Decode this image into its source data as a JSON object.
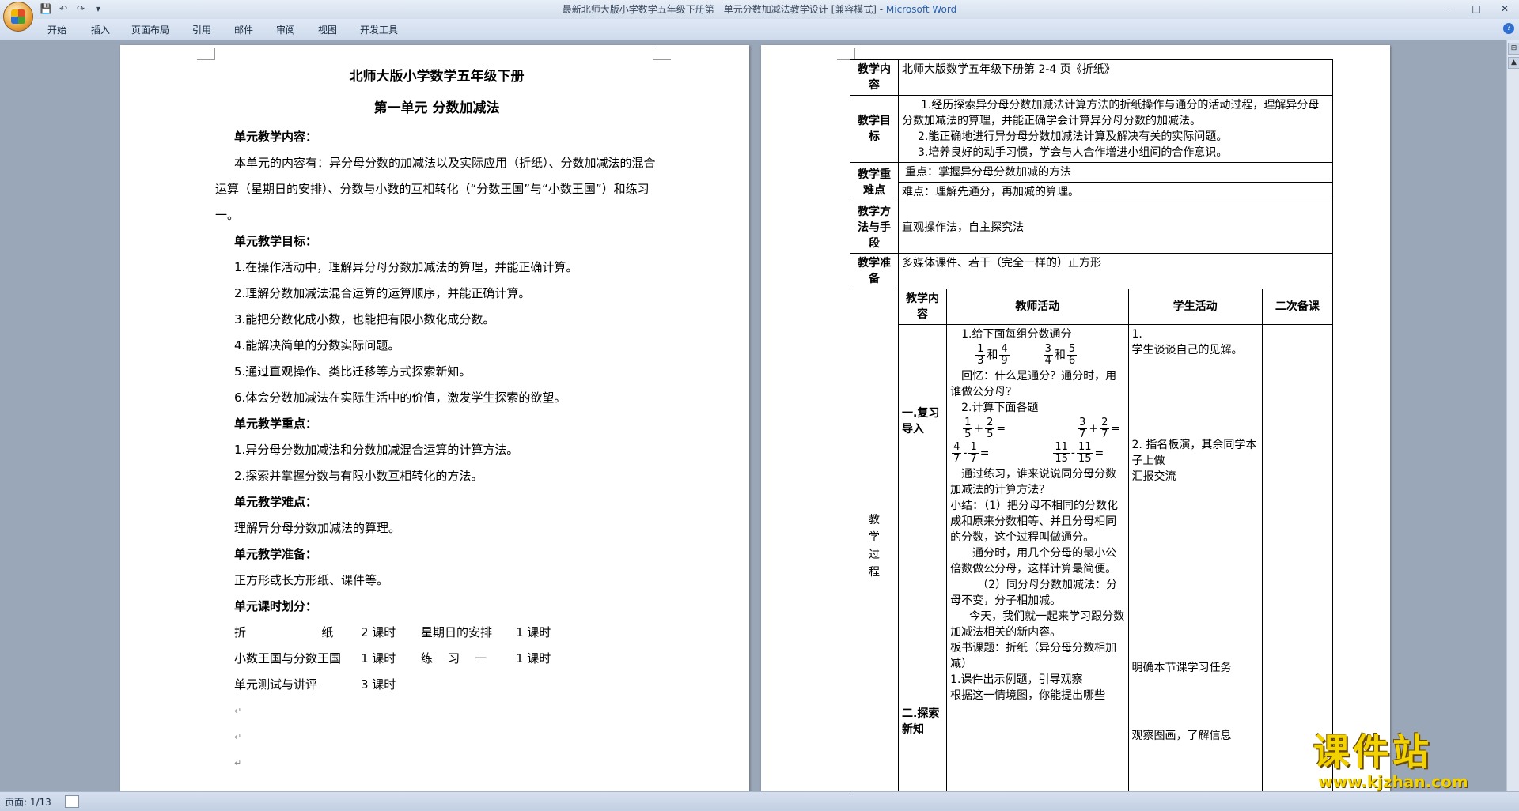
{
  "window": {
    "title": "最新北师大版小学数学五年级下册第一单元分数加减法教学设计 [兼容模式] - ",
    "app_name": "Microsoft Word",
    "minimize": "–",
    "maximize": "□",
    "close": "✕"
  },
  "ribbon": {
    "tabs": [
      "开始",
      "插入",
      "页面布局",
      "引用",
      "邮件",
      "审阅",
      "视图",
      "开发工具"
    ],
    "help": "?"
  },
  "left_page": {
    "title1": "北师大版小学数学五年级下册",
    "title2": "第一单元  分数加减法",
    "h_content": "单元教学内容：",
    "content_text": "本单元的内容有：异分母分数的加减法以及实际应用（折纸）、分数加减法的混合运算（星期日的安排）、分数与小数的互相转化（“分数王国”与“小数王国”）和练习一。",
    "h_goals": "单元教学目标：",
    "goals": [
      "1.在操作活动中，理解异分母分数加减法的算理，并能正确计算。",
      "2.理解分数加减法混合运算的运算顺序，并能正确计算。",
      "3.能把分数化成小数，也能把有限小数化成分数。",
      "4.能解决简单的分数实际问题。",
      "5.通过直观操作、类比迁移等方式探索新知。",
      "6.体会分数加减法在实际生活中的价值，激发学生探索的欲望。"
    ],
    "h_key": "单元教学重点：",
    "key": [
      "1.异分母分数加减法和分数加减混合运算的计算方法。",
      "2.探索并掌握分数与有限小数互相转化的方法。"
    ],
    "h_difficult": "单元教学难点：",
    "difficult": "理解异分母分数加减法的算理。",
    "h_prep": "单元教学准备：",
    "prep": "正方形或长方形纸、课件等。",
    "h_schedule": "单元课时划分：",
    "schedule": [
      [
        "折                    纸",
        "2 课时",
        "星期日的安排",
        "1 课时"
      ],
      [
        "小数王国与分数王国",
        "1 课时",
        "练    习    一",
        "1 课时"
      ],
      [
        "单元测试与讲评",
        "3 课时",
        "",
        ""
      ]
    ]
  },
  "right_page": {
    "rows": {
      "content_label": "教学内容",
      "content_value": "北师大版数学五年级下册第 2-4 页《折纸》",
      "goal_label": "教学目标",
      "goals": [
        "1.经历探索异分母分数加减法计算方法的折纸操作与通分的活动过程，理解异分母分数加减法的算理，并能正确学会计算异分母分数的加减法。",
        "2.能正确地进行异分母分数加减法计算及解决有关的实际问题。",
        "3.培养良好的动手习惯，学会与人合作增进小组间的合作意识。"
      ],
      "keydiff_label": "教学重难点",
      "key": "重点：掌握异分母分数加减的方法",
      "diff": "难点：理解先通分，再加减的算理。",
      "method_label": "教学方法与手段",
      "method": "直观操作法，自主探究法",
      "prep_label": "教学准备",
      "prep": "多媒体课件、若干（完全一样的）正方形"
    },
    "process": {
      "label": "教学过程",
      "h_content": "教学内容",
      "h_teacher": "教师活动",
      "h_student": "学生活动",
      "h_second": "二次备课",
      "stage1": "一.复习导入",
      "stage2": "二.探索新知",
      "t_1": "1.给下面每组分数通分",
      "fr_a": [
        "1",
        "3"
      ],
      "fr_b": [
        "4",
        "9"
      ],
      "fr_c": [
        "3",
        "4"
      ],
      "fr_d": [
        "5",
        "6"
      ],
      "and": "和",
      "t_recall": "回忆：什么是通分？通分时，用谁做公分母？",
      "t_2": "2.计算下面各题",
      "e1a": [
        "1",
        "5"
      ],
      "e1b": [
        "2",
        "5"
      ],
      "e2a": [
        "3",
        "7"
      ],
      "e2b": [
        "2",
        "7"
      ],
      "e3a": [
        "4",
        "7"
      ],
      "e3b": [
        "1",
        "7"
      ],
      "e4a": [
        "11",
        "15"
      ],
      "e4b": [
        "11",
        "15"
      ],
      "plus": "+",
      "minus": "-",
      "eq": "=",
      "t_practice": "通过练习，谁来说说同分母分数加减法的计算方法？",
      "t_summary": "小结：（1）把分母不相同的分数化成和原来分数相等、并且分母相同的分数，这个过程叫做通分。",
      "t_lcm": "通分时，用几个分母的最小公倍数做公分母，这样计算最简便。",
      "t_same": "（2）同分母分数加减法：分母不变，分子相加减。",
      "t_today": "今天，我们就一起来学习跟分数加减法相关的新内容。",
      "t_board": "板书课题：折纸（异分母分数相加减）",
      "t_ex1": "1.课件出示例题，引导观察",
      "t_ex2": "根据这一情境图，你能提出哪些",
      "s_1": "1.",
      "s_1b": "学生谈谈自己的见解。",
      "s_2": "2.  指名板演，其余同学本子上做",
      "s_3": "汇报交流",
      "s_4": "明确本节课学习任务",
      "s_5": "观察图画，了解信息"
    }
  },
  "status": {
    "page": "页面: 1/13"
  },
  "watermark": {
    "text": "课件站",
    "url": "www.kjzhan.com"
  }
}
